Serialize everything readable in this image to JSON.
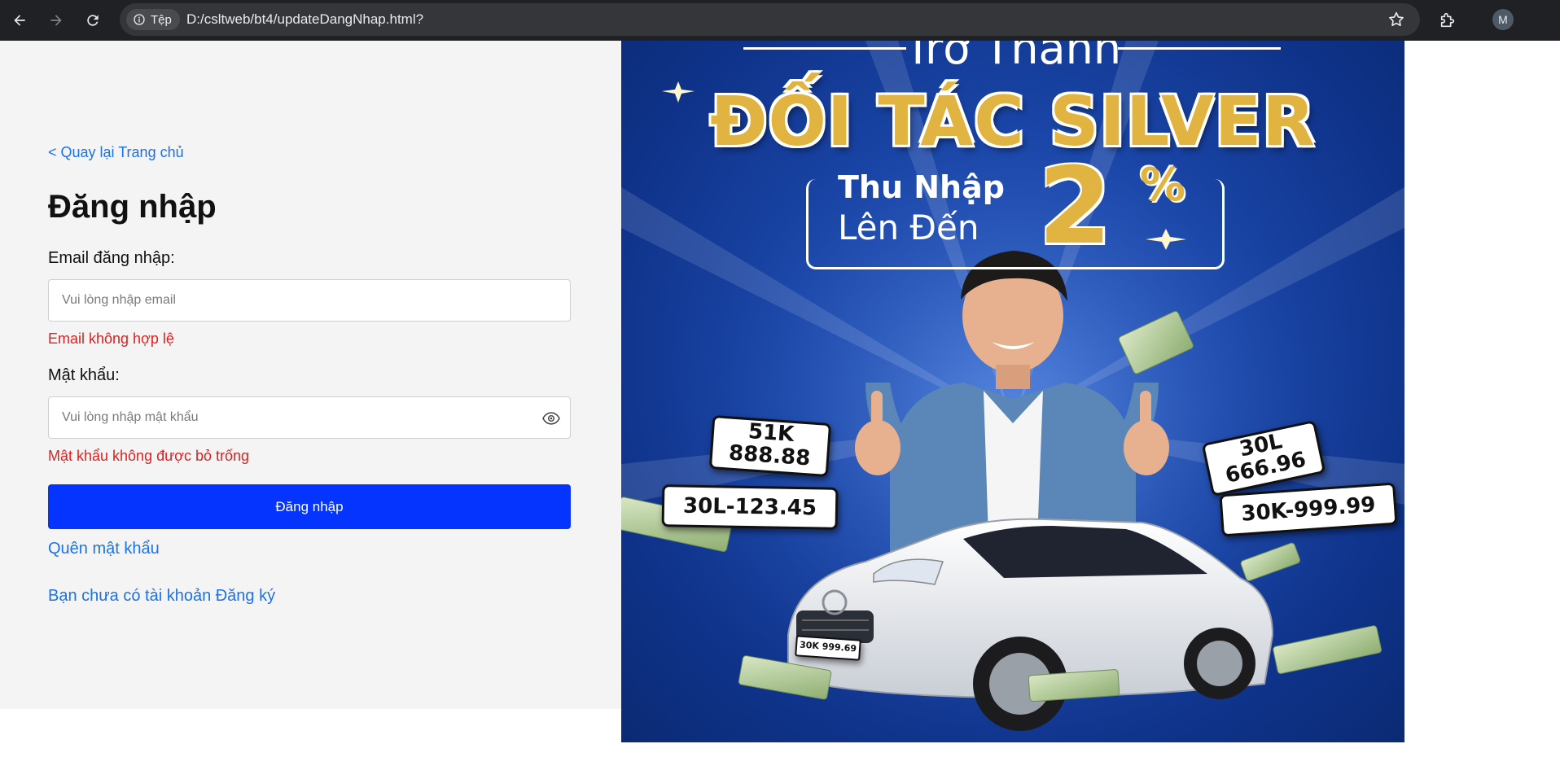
{
  "browser": {
    "site_chip_label": "Tệp",
    "url": "D:/csltweb/bt4/updateDangNhap.html?",
    "profile_initial": "M"
  },
  "login": {
    "back_link": "< Quay lại Trang chủ",
    "title": "Đăng nhập",
    "email_label": "Email đăng nhập:",
    "email_placeholder": "Vui lòng nhập email",
    "email_value": "",
    "email_error": "Email không hợp lệ",
    "password_label": "Mật khẩu:",
    "password_placeholder": "Vui lòng nhập mật khẩu",
    "password_value": "",
    "password_error": "Mật khẩu không được bỏ trống",
    "submit_label": "Đăng nhập",
    "forgot_link": "Quên mật khẩu",
    "register_link": "Bạn chưa có tài khoản Đăng ký"
  },
  "banner": {
    "top_text": "Trở Thành",
    "headline": "ĐỐI TÁC SILVER",
    "income_line1": "Thu Nhập",
    "income_line2": "Lên Đến",
    "income_number": "2",
    "income_percent": "%",
    "plates": [
      {
        "line1": "51K",
        "line2": "888.88"
      },
      {
        "line1": "30L-123.45"
      },
      {
        "line1": "30L",
        "line2": "666.96"
      },
      {
        "line1": "30K-999.99"
      },
      {
        "line1": "30K 999.69"
      }
    ]
  },
  "colors": {
    "primary_button": "#0534ff",
    "link": "#1a73e8",
    "error": "#e02020",
    "left_panel_bg": "#f4f4f4",
    "banner_gold": "#e1b340",
    "banner_blue": "#1a46a8"
  }
}
